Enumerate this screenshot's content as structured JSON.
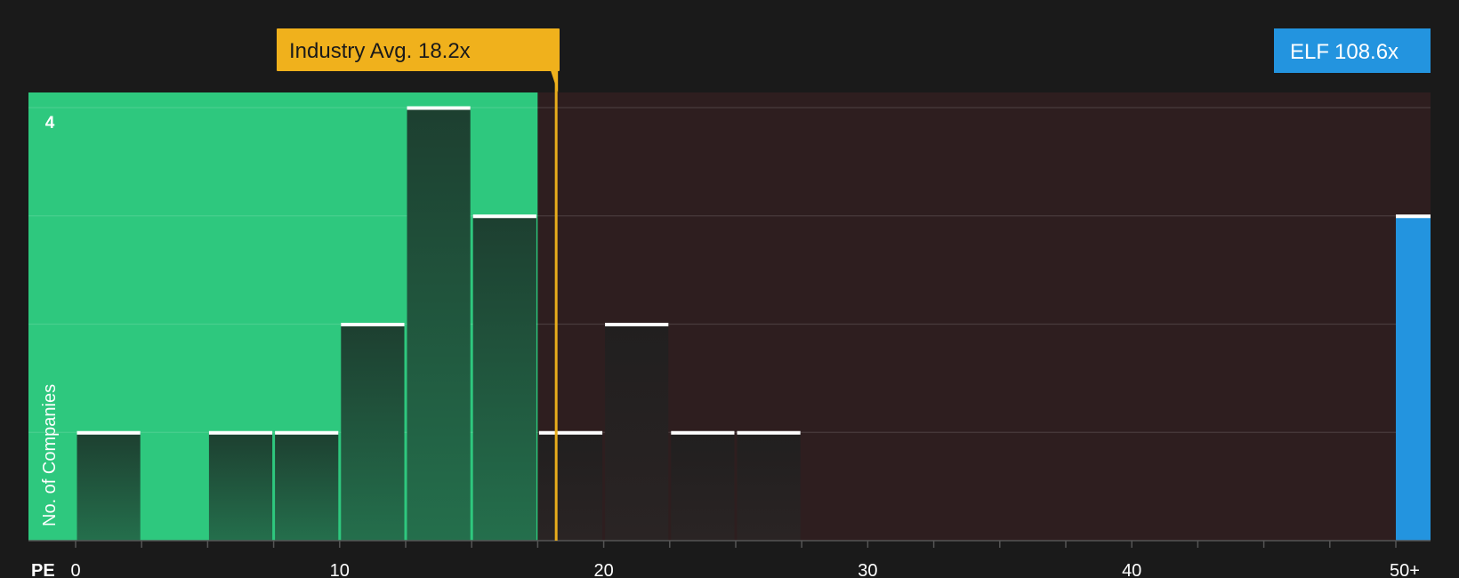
{
  "chart_data": {
    "type": "bar",
    "xlabel": "PE",
    "ylabel": "No. of Companies",
    "x_ticks": [
      "0",
      "10",
      "20",
      "30",
      "40",
      "50+"
    ],
    "x_tick_values": [
      0,
      10,
      20,
      30,
      40,
      50
    ],
    "xlim": [
      0,
      51.25
    ],
    "ylim": [
      0,
      4
    ],
    "y_tick_label": "4",
    "grid": true,
    "bin_width": 2.5,
    "bins": [
      {
        "start": 0,
        "end": 2.5,
        "count": 1
      },
      {
        "start": 5,
        "end": 7.5,
        "count": 1
      },
      {
        "start": 7.5,
        "end": 10,
        "count": 1
      },
      {
        "start": 10,
        "end": 12.5,
        "count": 2
      },
      {
        "start": 12.5,
        "end": 15,
        "count": 4
      },
      {
        "start": 15,
        "end": 17.5,
        "count": 3
      },
      {
        "start": 17.5,
        "end": 20,
        "count": 1
      },
      {
        "start": 20,
        "end": 22.5,
        "count": 2
      },
      {
        "start": 22.5,
        "end": 25,
        "count": 1
      },
      {
        "start": 25,
        "end": 27.5,
        "count": 1
      },
      {
        "start": 50,
        "end": 51.25,
        "count": 3,
        "highlight": true
      }
    ],
    "industry_avg": {
      "value": 18.2,
      "label": "Industry Avg. 18.2x"
    },
    "company": {
      "ticker": "ELF",
      "value_label": "108.6x",
      "count": 3
    },
    "fair_range_end": 17.5,
    "colors": {
      "background": "#1a1a1a",
      "green_zone": "#2ec87e",
      "red_zone": "#2e1e1f",
      "bar_in_green": "#1f4a36",
      "bar_in_red": "#262222",
      "bar_cap": "#ffffff",
      "industry_line": "#e8ac1c",
      "industry_badge": "#f0b11c",
      "company_bar": "#2394df",
      "company_badge": "#2394df",
      "text": "#ffffff"
    }
  }
}
